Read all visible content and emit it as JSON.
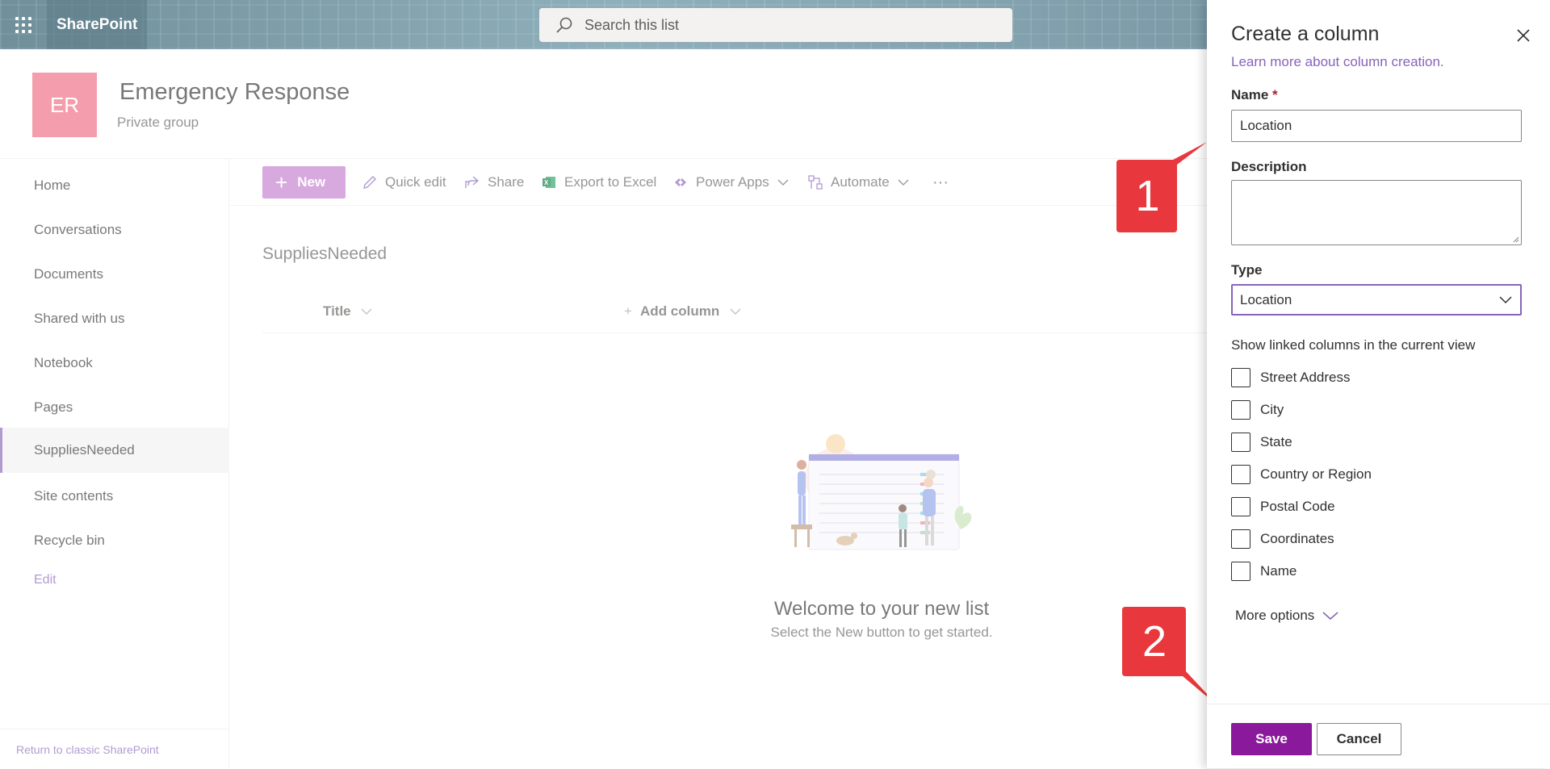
{
  "suite": {
    "app_name": "SharePoint",
    "search_placeholder": "Search this list"
  },
  "site": {
    "logo_initials": "ER",
    "logo_color": "#ee6b82",
    "title": "Emergency Response",
    "subtitle": "Private group"
  },
  "nav": {
    "items": [
      {
        "label": "Home"
      },
      {
        "label": "Conversations"
      },
      {
        "label": "Documents"
      },
      {
        "label": "Shared with us"
      },
      {
        "label": "Notebook"
      },
      {
        "label": "Pages"
      },
      {
        "label": "SuppliesNeeded",
        "selected": true
      },
      {
        "label": "Site contents"
      },
      {
        "label": "Recycle bin"
      }
    ],
    "edit_label": "Edit",
    "footer_link": "Return to classic SharePoint"
  },
  "commandbar": {
    "new_label": "New",
    "quick_edit": "Quick edit",
    "share": "Share",
    "export_excel": "Export to Excel",
    "power_apps": "Power Apps",
    "automate": "Automate",
    "overflow": "···"
  },
  "list": {
    "title": "SuppliesNeeded",
    "columns": [
      {
        "label": "Title"
      },
      {
        "label": "Add column",
        "prefix": "+"
      }
    ],
    "empty_title": "Welcome to your new list",
    "empty_subtitle": "Select the New button to get started."
  },
  "panel": {
    "title": "Create a column",
    "learn_more": "Learn more about column creation.",
    "name_label": "Name",
    "required_mark": "*",
    "name_value": "Location",
    "description_label": "Description",
    "description_value": "",
    "type_label": "Type",
    "type_value": "Location",
    "linked_label": "Show linked columns in the current view",
    "linked_columns": [
      {
        "label": "Street Address",
        "checked": false
      },
      {
        "label": "City",
        "checked": false
      },
      {
        "label": "State",
        "checked": false
      },
      {
        "label": "Country or Region",
        "checked": false
      },
      {
        "label": "Postal Code",
        "checked": false
      },
      {
        "label": "Coordinates",
        "checked": false
      },
      {
        "label": "Name",
        "checked": false
      }
    ],
    "more_options": "More options",
    "save_label": "Save",
    "cancel_label": "Cancel"
  },
  "callouts": [
    {
      "number": "1"
    },
    {
      "number": "2"
    }
  ],
  "colors": {
    "accent": "#8764b8",
    "save": "#8a1a9b",
    "new_button": "#c47bce",
    "callout": "#e8383d"
  }
}
